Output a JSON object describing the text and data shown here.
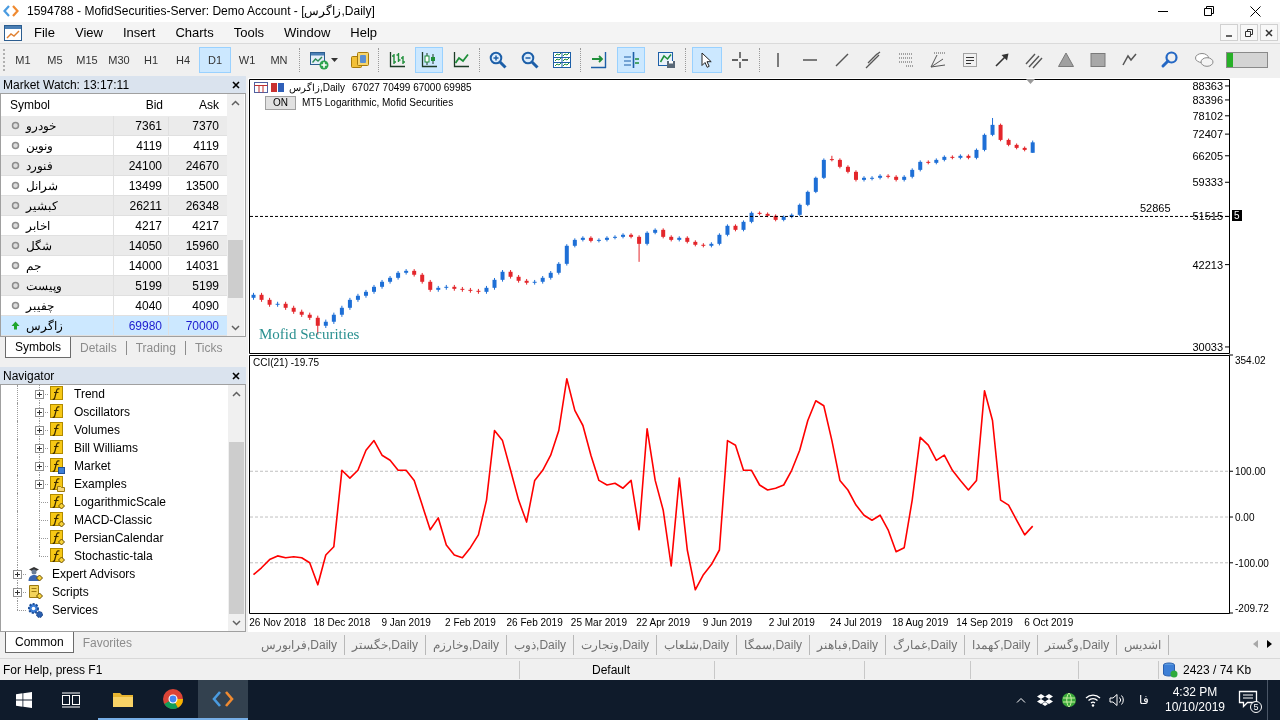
{
  "window": {
    "title": "1594788 - MofidSecurities-Server: Demo Account - [زاگرس,Daily]"
  },
  "menu": [
    "File",
    "View",
    "Insert",
    "Charts",
    "Tools",
    "Window",
    "Help"
  ],
  "toolbar": {
    "timeframes": [
      {
        "label": "M1",
        "selected": false
      },
      {
        "label": "M5",
        "selected": false
      },
      {
        "label": "M15",
        "selected": false
      },
      {
        "label": "M30",
        "selected": false
      },
      {
        "label": "H1",
        "selected": false
      },
      {
        "label": "H4",
        "selected": false
      },
      {
        "label": "D1",
        "selected": true
      },
      {
        "label": "W1",
        "selected": false
      },
      {
        "label": "MN",
        "selected": false
      }
    ],
    "chart_types": [
      {
        "kind": "bars",
        "selected": false
      },
      {
        "kind": "candles",
        "selected": true
      },
      {
        "kind": "line",
        "selected": false
      }
    ],
    "chart_toggles": [
      {
        "kind": "auto_scroll",
        "on": false
      },
      {
        "kind": "chart_shift",
        "on": true
      }
    ],
    "pointer_modes": [
      {
        "kind": "cursor",
        "selected": true
      },
      {
        "kind": "crosshair",
        "selected": false
      }
    ]
  },
  "market_watch": {
    "title": "Market Watch: 13:17:11",
    "columns": [
      "Symbol",
      "Bid",
      "Ask"
    ],
    "rows": [
      {
        "symbol": "خودرو",
        "bid": "7361",
        "ask": "7370",
        "kind": "unchanged",
        "selected": false
      },
      {
        "symbol": "ونوین",
        "bid": "4119",
        "ask": "4119",
        "kind": "unchanged",
        "selected": false
      },
      {
        "symbol": "فنورد",
        "bid": "24100",
        "ask": "24670",
        "kind": "unchanged",
        "selected": false
      },
      {
        "symbol": "شرانل",
        "bid": "13499",
        "ask": "13500",
        "kind": "unchanged",
        "selected": false
      },
      {
        "symbol": "کبشیر",
        "bid": "26211",
        "ask": "26348",
        "kind": "unchanged",
        "selected": false
      },
      {
        "symbol": "اخابر",
        "bid": "4217",
        "ask": "4217",
        "kind": "unchanged",
        "selected": false
      },
      {
        "symbol": "شگل",
        "bid": "14050",
        "ask": "15960",
        "kind": "unchanged",
        "selected": false
      },
      {
        "symbol": "جم",
        "bid": "14000",
        "ask": "14031",
        "kind": "unchanged",
        "selected": false
      },
      {
        "symbol": "وپیست",
        "bid": "5199",
        "ask": "5199",
        "kind": "unchanged",
        "selected": false
      },
      {
        "symbol": "چفیبر",
        "bid": "4040",
        "ask": "4090",
        "kind": "unchanged",
        "selected": false
      },
      {
        "symbol": "زاگرس",
        "bid": "69980",
        "ask": "70000",
        "kind": "up",
        "selected": true
      }
    ],
    "tabs": [
      {
        "label": "Symbols",
        "selected": true
      },
      {
        "label": "Details",
        "selected": false
      },
      {
        "label": "Trading",
        "selected": false
      },
      {
        "label": "Ticks",
        "selected": false
      }
    ]
  },
  "navigator": {
    "title": "Navigator",
    "tree": [
      {
        "children": [
          {
            "label": "Trend",
            "kind": "folder",
            "expanded": false
          },
          {
            "label": "Oscillators",
            "kind": "folder",
            "expanded": false
          },
          {
            "label": "Volumes",
            "kind": "folder",
            "expanded": false
          },
          {
            "label": "Bill Williams",
            "kind": "folder",
            "expanded": false
          },
          {
            "label": "Market",
            "kind": "market",
            "expanded": false
          },
          {
            "label": "Examples",
            "kind": "examples",
            "expanded": false
          },
          {
            "label": "LogarithmicScale",
            "kind": "indicator"
          },
          {
            "label": "MACD-Classic",
            "kind": "indicator"
          },
          {
            "label": "PersianCalendar",
            "kind": "indicator"
          },
          {
            "label": "Stochastic-tala",
            "kind": "indicator"
          }
        ]
      },
      {
        "label": "Expert Advisors",
        "kind": "experts",
        "expanded": false
      },
      {
        "label": "Scripts",
        "kind": "scripts",
        "expanded": false
      },
      {
        "label": "Services",
        "kind": "services"
      }
    ],
    "tabs": [
      {
        "label": "Common",
        "selected": true
      },
      {
        "label": "Favorites",
        "selected": false
      }
    ]
  },
  "chart": {
    "symbol": "زاگرس,Daily",
    "prices": "67027 70499 67000 69985",
    "on_button": "ON",
    "indicator_label": "MT5 Logarithmic, Mofid Securities",
    "price_tag": "5",
    "chart_data": [
      {
        "type": "candlestick",
        "log": true,
        "ylim": [
          29290,
          90940
        ],
        "yticks": [
          88363,
          83396,
          78102,
          72407,
          66205,
          59333,
          51515,
          42213,
          30033
        ],
        "tick_labels": "y",
        "ref_lines": [
          {
            "axis": "y",
            "value": 51515,
            "color": "#000000",
            "line_style": "dashed"
          }
        ],
        "annotations": [
          "52865",
          "Mofid Securities"
        ],
        "categories": [
          null,
          null,
          null,
          null,
          null,
          null,
          null,
          null,
          null,
          null,
          null,
          null,
          null,
          null,
          null,
          null,
          null,
          null,
          null,
          null,
          null,
          null,
          null,
          null,
          null,
          null,
          null,
          null,
          null,
          null,
          null,
          null,
          null,
          null,
          null,
          null,
          null,
          null,
          null,
          null,
          null,
          null,
          null,
          null,
          null,
          null,
          null,
          null,
          null,
          null,
          null,
          null,
          null,
          null,
          null,
          null,
          null,
          null,
          null,
          null,
          null,
          null,
          null,
          null,
          null,
          null,
          null,
          null,
          null,
          null,
          null,
          null,
          null,
          null,
          null,
          null,
          null,
          null,
          null,
          null,
          null,
          null,
          null,
          null,
          null,
          null,
          null,
          null,
          null,
          null,
          null,
          null,
          null,
          null,
          null,
          null,
          null,
          null,
          null,
          null,
          null,
          null,
          null,
          null,
          null,
          null,
          null,
          null,
          null,
          null,
          null,
          null,
          null,
          null,
          null,
          null,
          null,
          null,
          null,
          null,
          null,
          null
        ],
        "ohlc": [
          [
            36800,
            37560,
            36500,
            37260
          ],
          [
            37260,
            37560,
            36190,
            36490
          ],
          [
            36490,
            36790,
            35460,
            35760
          ],
          [
            35760,
            36200,
            35460,
            35900
          ],
          [
            35900,
            36200,
            35010,
            35310
          ],
          [
            35310,
            35610,
            34440,
            34740
          ],
          [
            34740,
            35040,
            34010,
            34310
          ],
          [
            34310,
            34610,
            33580,
            33880
          ],
          [
            33880,
            34180,
            31600,
            32780
          ],
          [
            32780,
            33630,
            32480,
            33330
          ],
          [
            33330,
            34610,
            33030,
            34310
          ],
          [
            34310,
            35610,
            34010,
            35310
          ],
          [
            35310,
            36790,
            35010,
            36490
          ],
          [
            36490,
            37410,
            36190,
            37110
          ],
          [
            37110,
            38020,
            36810,
            37720
          ],
          [
            37720,
            38810,
            37420,
            38510
          ],
          [
            38510,
            39620,
            38210,
            39320
          ],
          [
            39320,
            40270,
            39020,
            39970
          ],
          [
            39970,
            41110,
            39670,
            40810
          ],
          [
            40810,
            41440,
            40510,
            41140
          ],
          [
            41140,
            41440,
            40180,
            40480
          ],
          [
            40480,
            40780,
            39020,
            39320
          ],
          [
            39320,
            39620,
            37730,
            38030
          ],
          [
            38030,
            38650,
            37730,
            38350
          ],
          [
            38350,
            38810,
            38050,
            38510
          ],
          [
            38510,
            38810,
            37890,
            38190
          ],
          [
            38190,
            38490,
            37730,
            38030
          ],
          [
            38030,
            38330,
            37580,
            37880
          ],
          [
            37880,
            38180,
            37420,
            37720
          ],
          [
            37720,
            38650,
            37420,
            38350
          ],
          [
            38350,
            39940,
            38050,
            39640
          ],
          [
            39640,
            41280,
            39340,
            40980
          ],
          [
            40980,
            41280,
            39840,
            40140
          ],
          [
            40140,
            40440,
            39180,
            39480
          ],
          [
            39480,
            39780,
            38860,
            39160
          ],
          [
            39160,
            39620,
            38860,
            39320
          ],
          [
            39320,
            40270,
            39020,
            39970
          ],
          [
            39970,
            41110,
            39670,
            40810
          ],
          [
            40810,
            42650,
            40510,
            42350
          ],
          [
            42350,
            45930,
            42050,
            45630
          ],
          [
            45630,
            47060,
            45330,
            46760
          ],
          [
            46760,
            47460,
            46460,
            47160
          ],
          [
            47160,
            47460,
            46270,
            46570
          ],
          [
            46570,
            47060,
            46270,
            46760
          ],
          [
            46760,
            47460,
            46460,
            47160
          ],
          [
            47160,
            47650,
            46860,
            47350
          ],
          [
            47350,
            48050,
            47050,
            47750
          ],
          [
            47750,
            48050,
            47050,
            47350
          ],
          [
            47350,
            47650,
            42700,
            46000
          ],
          [
            46000,
            48450,
            45700,
            48150
          ],
          [
            48150,
            49040,
            47850,
            48740
          ],
          [
            48740,
            49040,
            47050,
            47350
          ],
          [
            47350,
            47650,
            46460,
            46760
          ],
          [
            46760,
            47460,
            46460,
            47160
          ],
          [
            47160,
            47460,
            46080,
            46380
          ],
          [
            46380,
            46680,
            45520,
            45820
          ],
          [
            45820,
            46120,
            45330,
            45630
          ],
          [
            45630,
            46300,
            45330,
            46000
          ],
          [
            46000,
            48050,
            45700,
            47750
          ],
          [
            47750,
            49860,
            47450,
            49560
          ],
          [
            49560,
            49860,
            48440,
            48740
          ],
          [
            48740,
            50680,
            48440,
            50380
          ],
          [
            50380,
            52590,
            50080,
            52290
          ],
          [
            52290,
            52590,
            51770,
            52070
          ],
          [
            52070,
            52370,
            51350,
            51650
          ],
          [
            51650,
            51950,
            50490,
            50790
          ],
          [
            50790,
            51730,
            50490,
            51430
          ],
          [
            51430,
            52160,
            51130,
            51860
          ],
          [
            51860,
            54350,
            51560,
            54050
          ],
          [
            54050,
            57330,
            53750,
            57030
          ],
          [
            57030,
            60740,
            56730,
            60440
          ],
          [
            60440,
            65490,
            60140,
            65090
          ],
          [
            65300,
            66200,
            64690,
            65090
          ],
          [
            65090,
            65490,
            62850,
            63250
          ],
          [
            63250,
            63650,
            61550,
            61950
          ],
          [
            61950,
            62350,
            59530,
            59930
          ],
          [
            59930,
            60840,
            59530,
            60440
          ],
          [
            60200,
            60840,
            59800,
            60440
          ],
          [
            60440,
            61340,
            60040,
            60940
          ],
          [
            60940,
            61340,
            60290,
            60690
          ],
          [
            60690,
            61090,
            59530,
            59930
          ],
          [
            59930,
            61090,
            59530,
            60690
          ],
          [
            60690,
            62860,
            60290,
            62460
          ],
          [
            62460,
            64960,
            62060,
            64560
          ],
          [
            64560,
            64960,
            63900,
            64300
          ],
          [
            64300,
            65490,
            63900,
            65090
          ],
          [
            65090,
            66310,
            64690,
            65910
          ],
          [
            65910,
            66310,
            65240,
            65640
          ],
          [
            65640,
            66590,
            65240,
            66190
          ],
          [
            66190,
            66590,
            65240,
            65640
          ],
          [
            65640,
            68230,
            65240,
            67830
          ],
          [
            67830,
            72590,
            67430,
            72190
          ],
          [
            72190,
            77400,
            71790,
            75230
          ],
          [
            75230,
            75630,
            70290,
            70690
          ],
          [
            70690,
            71090,
            68860,
            69260
          ],
          [
            69260,
            69660,
            68000,
            68400
          ],
          [
            68400,
            68800,
            67430,
            67830
          ],
          [
            67027,
            70499,
            67000,
            69985
          ],
          null,
          null,
          null,
          null,
          null,
          null,
          null,
          null,
          null,
          null,
          null,
          null,
          null,
          null,
          null,
          null,
          null,
          null,
          null,
          null,
          null,
          null,
          null,
          null
        ]
      },
      {
        "type": "line",
        "title": "CCI(21) -19.75",
        "color": "#ff0000",
        "ylim": [
          -209.72,
          354.02
        ],
        "yticks": [
          {
            "value": 354.02,
            "label": "354.02"
          },
          {
            "value": 100,
            "label": "100.00"
          },
          {
            "value": 0,
            "label": "0.00"
          },
          {
            "value": -100,
            "label": "-100.00"
          },
          {
            "value": -209.72,
            "label": "-209.72"
          }
        ],
        "ref_lines": [
          {
            "axis": "y",
            "value": 100,
            "color": "#c0c0c0",
            "line_style": "dashed"
          },
          {
            "axis": "y",
            "value": 0,
            "color": "#c0c0c0",
            "line_style": "dashed"
          },
          {
            "axis": "y",
            "value": -100,
            "color": "#c0c0c0",
            "line_style": "dashed"
          }
        ],
        "categories": [
          null,
          null,
          null,
          "26 Nov 2018",
          null,
          null,
          null,
          null,
          null,
          null,
          null,
          "18 Dec 2018",
          null,
          null,
          null,
          null,
          null,
          null,
          null,
          "9 Jan 2019",
          null,
          null,
          null,
          null,
          null,
          null,
          null,
          "2 Feb 2019",
          null,
          null,
          null,
          null,
          null,
          null,
          null,
          "26 Feb 2019",
          null,
          null,
          null,
          null,
          null,
          null,
          null,
          "25 Mar 2019",
          null,
          null,
          null,
          null,
          null,
          null,
          null,
          "22 Apr 2019",
          null,
          null,
          null,
          null,
          null,
          null,
          null,
          "9 Jun 2019",
          null,
          null,
          null,
          null,
          null,
          null,
          null,
          "2 Jul 2019",
          null,
          null,
          null,
          null,
          null,
          null,
          null,
          "24 Jul 2019",
          null,
          null,
          null,
          null,
          null,
          null,
          null,
          "18 Aug 2019",
          null,
          null,
          null,
          null,
          null,
          null,
          null,
          "14 Sep 2019",
          null,
          null,
          null,
          null,
          null,
          null,
          null,
          "6 Oct 2019",
          null,
          null,
          null,
          null,
          null,
          null,
          null,
          null,
          null,
          null,
          null,
          null,
          null,
          null,
          null,
          null,
          null,
          null,
          null,
          null,
          null,
          null
        ],
        "values": [
          -126,
          -111,
          -93,
          -85,
          -89,
          -87,
          -89,
          -100,
          -148,
          -83,
          -65,
          102,
          85,
          102,
          146,
          167,
          135,
          124,
          102,
          102,
          80,
          26,
          -28,
          -2,
          -61,
          -83,
          -89,
          -67,
          -39,
          37,
          189,
          167,
          102,
          37,
          -11,
          80,
          102,
          135,
          189,
          302,
          233,
          200,
          135,
          80,
          70,
          74,
          63,
          80,
          -28,
          193,
          80,
          15,
          -107,
          85,
          -72,
          -159,
          -126,
          -104,
          -72,
          167,
          157,
          102,
          102,
          70,
          59,
          63,
          70,
          102,
          146,
          211,
          254,
          243,
          167,
          80,
          59,
          26,
          4,
          -7,
          4,
          -28,
          -76,
          -67,
          37,
          174,
          157,
          124,
          135,
          102,
          80,
          59,
          80,
          276,
          211,
          37,
          26,
          -7,
          -39,
          -19.75,
          null,
          null,
          null,
          null,
          null,
          null,
          null,
          null,
          null,
          null,
          null,
          null,
          null,
          null,
          null,
          null,
          null,
          null,
          null,
          null,
          null,
          null,
          null,
          null
        ]
      }
    ]
  },
  "chart_tabs": [
    {
      "label": "فرابورس,Daily",
      "selected": false
    },
    {
      "label": "خگستر,Daily",
      "selected": false
    },
    {
      "label": "وخارزم,Daily",
      "selected": false
    },
    {
      "label": "ذوب,Daily",
      "selected": false
    },
    {
      "label": "وتجارت,Daily",
      "selected": false
    },
    {
      "label": "شلعاب,Daily",
      "selected": false
    },
    {
      "label": "سمگا,Daily",
      "selected": false
    },
    {
      "label": "فباهنر,Daily",
      "selected": false
    },
    {
      "label": "غمارگ,Daily",
      "selected": false
    },
    {
      "label": "کهمدا,Daily",
      "selected": false
    },
    {
      "label": "وگستر,Daily",
      "selected": false
    },
    {
      "label": "اشدیس",
      "selected": false
    }
  ],
  "status_bar": {
    "help": "For Help, press F1",
    "profile": "Default",
    "traffic": "2423 / 74 Kb"
  },
  "taskbar": {
    "apps": [
      {
        "kind": "files",
        "active": false
      },
      {
        "kind": "browser",
        "active": false
      },
      {
        "kind": "terminal",
        "active": true
      }
    ],
    "language": "فا",
    "time": "4:32 PM",
    "date": "10/10/2019",
    "notifications": "5"
  }
}
